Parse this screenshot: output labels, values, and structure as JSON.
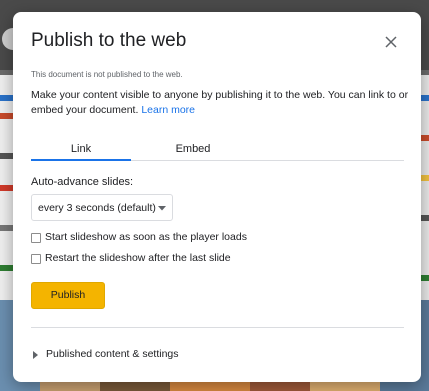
{
  "dialog": {
    "title": "Publish to the web",
    "close_icon": "close-icon",
    "status_note": "This document is not published to the web.",
    "description": "Make your content visible to anyone by publishing it to the web. You can link to or embed your document.",
    "learn_more": "Learn more",
    "tabs": [
      {
        "label": "Link",
        "active": true
      },
      {
        "label": "Embed",
        "active": false
      }
    ],
    "auto_advance": {
      "label": "Auto-advance slides:",
      "selected": "every 3 seconds (default)",
      "caret_icon": "caret-down-icon"
    },
    "checkboxes": [
      {
        "label": "Start slideshow as soon as the player loads",
        "checked": false
      },
      {
        "label": "Restart the slideshow after the last slide",
        "checked": false
      }
    ],
    "publish_button": "Publish",
    "publish_color": "#f4b400",
    "accent_color": "#1a73e8",
    "section": {
      "label": "Published content & settings",
      "icon": "triangle-right-icon"
    }
  }
}
